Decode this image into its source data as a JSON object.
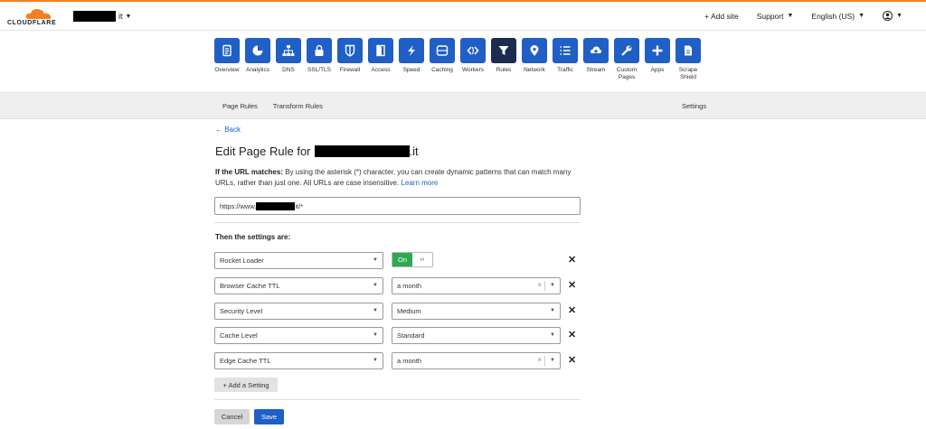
{
  "brand": {
    "logo_text": "CLOUDFLARE",
    "accent": "#f38020"
  },
  "header": {
    "domain_suffix": "it",
    "add_site": "+ Add site",
    "support": "Support",
    "language": "English (US)"
  },
  "nav": [
    {
      "label": "Overview",
      "icon": "document-icon"
    },
    {
      "label": "Analytics",
      "icon": "pie-chart-icon"
    },
    {
      "label": "DNS",
      "icon": "network-icon"
    },
    {
      "label": "SSL/TLS",
      "icon": "lock-icon"
    },
    {
      "label": "Firewall",
      "icon": "shield-icon"
    },
    {
      "label": "Access",
      "icon": "door-icon"
    },
    {
      "label": "Speed",
      "icon": "lightning-icon"
    },
    {
      "label": "Caching",
      "icon": "server-icon"
    },
    {
      "label": "Workers",
      "icon": "code-icon"
    },
    {
      "label": "Rules",
      "icon": "filter-icon",
      "active": true
    },
    {
      "label": "Network",
      "icon": "location-pin-icon"
    },
    {
      "label": "Traffic",
      "icon": "list-icon"
    },
    {
      "label": "Stream",
      "icon": "cloud-upload-icon"
    },
    {
      "label": "Custom Pages",
      "icon": "wrench-icon"
    },
    {
      "label": "Apps",
      "icon": "plus-icon"
    },
    {
      "label": "Scrape Shield",
      "icon": "page-icon"
    }
  ],
  "subnav": {
    "page_rules": "Page Rules",
    "transform_rules": "Transform Rules",
    "settings": "Settings"
  },
  "back": "← Back",
  "page": {
    "title_prefix": "Edit Page Rule for",
    "title_suffix": ".it",
    "url_label": "If the URL matches:",
    "url_desc": "By using the asterisk (*) character, you can create dynamic patterns that can match many URLs, rather than just one. All URLs are case insensitive.",
    "learn_more": "Learn more",
    "url_prefix": "https://www.",
    "url_suffix": "it/*",
    "settings_heading": "Then the settings are:"
  },
  "settings": [
    {
      "name": "Rocket Loader",
      "value": "On",
      "type": "toggle"
    },
    {
      "name": "Browser Cache TTL",
      "value": "a month",
      "clearable": true
    },
    {
      "name": "Security Level",
      "value": "Medium"
    },
    {
      "name": "Cache Level",
      "value": "Standard"
    },
    {
      "name": "Edge Cache TTL",
      "value": "a month",
      "clearable": true
    }
  ],
  "toggle_code": "‹›",
  "buttons": {
    "add_setting": "+ Add a Setting",
    "cancel": "Cancel",
    "save": "Save"
  }
}
